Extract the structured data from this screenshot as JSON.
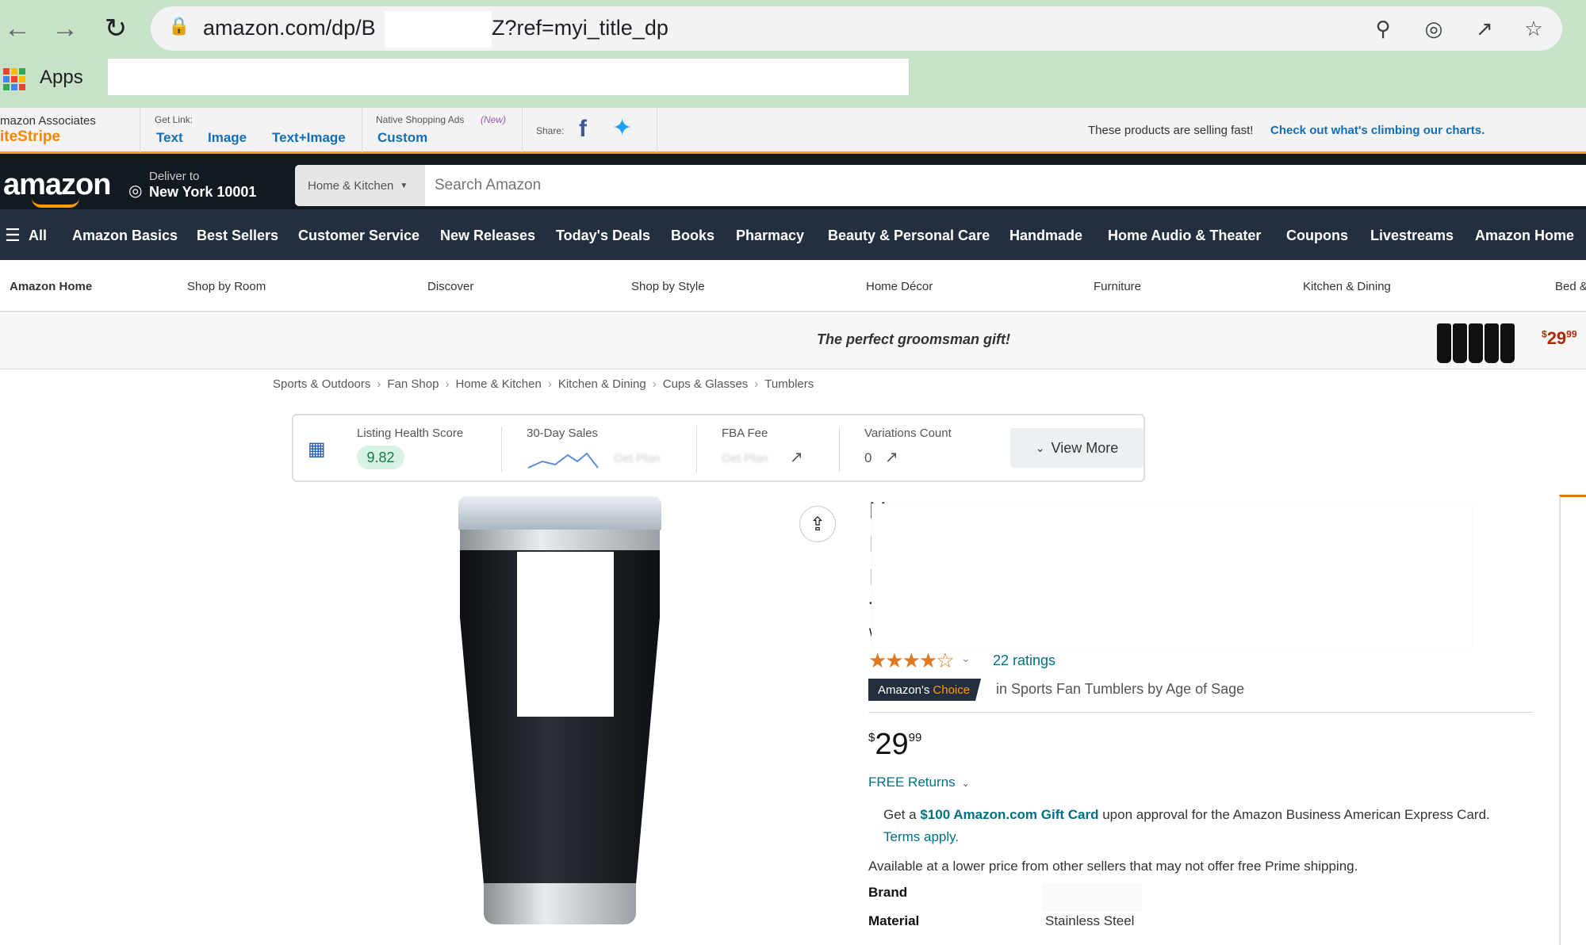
{
  "browser": {
    "url_prefix": "amazon.com/dp/B",
    "url_suffix": "Z?ref=myi_title_dp",
    "bookmarks_apps": "Apps"
  },
  "sitestripe": {
    "brand_line1": "mazon Associates",
    "brand_line2": "iteStripe",
    "get_link_label": "Get Link:",
    "links": [
      "Text",
      "Image",
      "Text+Image"
    ],
    "native_label": "Native Shopping Ads",
    "native_new": "(New)",
    "custom": "Custom",
    "share_label": "Share:",
    "notice": "These products are selling fast!",
    "notice_link": "Check out what's climbing our charts."
  },
  "header": {
    "logo": "amazon",
    "deliver_line1": "Deliver to",
    "deliver_line2": "New York 10001",
    "search_dept": "Home & Kitchen",
    "search_placeholder": "Search Amazon"
  },
  "nav": {
    "all": "All",
    "items": [
      "Amazon Basics",
      "Best Sellers",
      "Customer Service",
      "New Releases",
      "Today's Deals",
      "Books",
      "Pharmacy",
      "Beauty & Personal Care",
      "Handmade",
      "Home Audio & Theater",
      "Coupons",
      "Livestreams",
      "Amazon Home"
    ]
  },
  "subnav": {
    "items": [
      "Amazon Home",
      "Shop by Room",
      "Discover",
      "Shop by Style",
      "Home Décor",
      "Furniture",
      "Kitchen & Dining",
      "Bed &"
    ]
  },
  "promo": {
    "text": "The perfect groomsman gift!",
    "price_symbol": "$",
    "price_whole": "29",
    "price_frac": "99"
  },
  "breadcrumb": [
    "Sports & Outdoors",
    "Fan Shop",
    "Home & Kitchen",
    "Kitchen & Dining",
    "Cups & Glasses",
    "Tumblers"
  ],
  "extension": {
    "health_label": "Listing Health Score",
    "health_value": "9.82",
    "sales_label": "30-Day Sales",
    "sales_blur": "Get Plan",
    "fba_label": "FBA Fee",
    "fba_blur": "Get Plan",
    "variations_label": "Variations Count",
    "variations_value": "0",
    "view_more": "View More"
  },
  "product": {
    "title_fragments": [
      "H",
      "I",
      "I",
      "T",
      "\\"
    ],
    "stars": "★★★★☆",
    "rating_value": 4.5,
    "ratings": "22 ratings",
    "choice_amazon": "Amazon's",
    "choice_word": "Choice",
    "choice_category": "in Sports Fan Tumblers by Age of Sage",
    "price_symbol": "$",
    "price_whole": "29",
    "price_frac": "99",
    "free_returns": "FREE Returns",
    "gift_pre": "Get a",
    "gift_bold": "$100 Amazon.com Gift Card",
    "gift_post": "upon approval for the Amazon Business American Express Card.",
    "gift_terms": "Terms apply.",
    "lower_price": "Available at a lower price from other sellers that may not offer free Prime shipping.",
    "specs": [
      {
        "key": "Brand",
        "value": ""
      },
      {
        "key": "Material",
        "value": "Stainless Steel"
      }
    ]
  },
  "colors": {
    "chrome": "#c7e2c6",
    "amazon_dark": "#131921",
    "amazon_nav": "#232f3e",
    "accent_orange": "#ff9900",
    "link_teal": "#007185"
  }
}
